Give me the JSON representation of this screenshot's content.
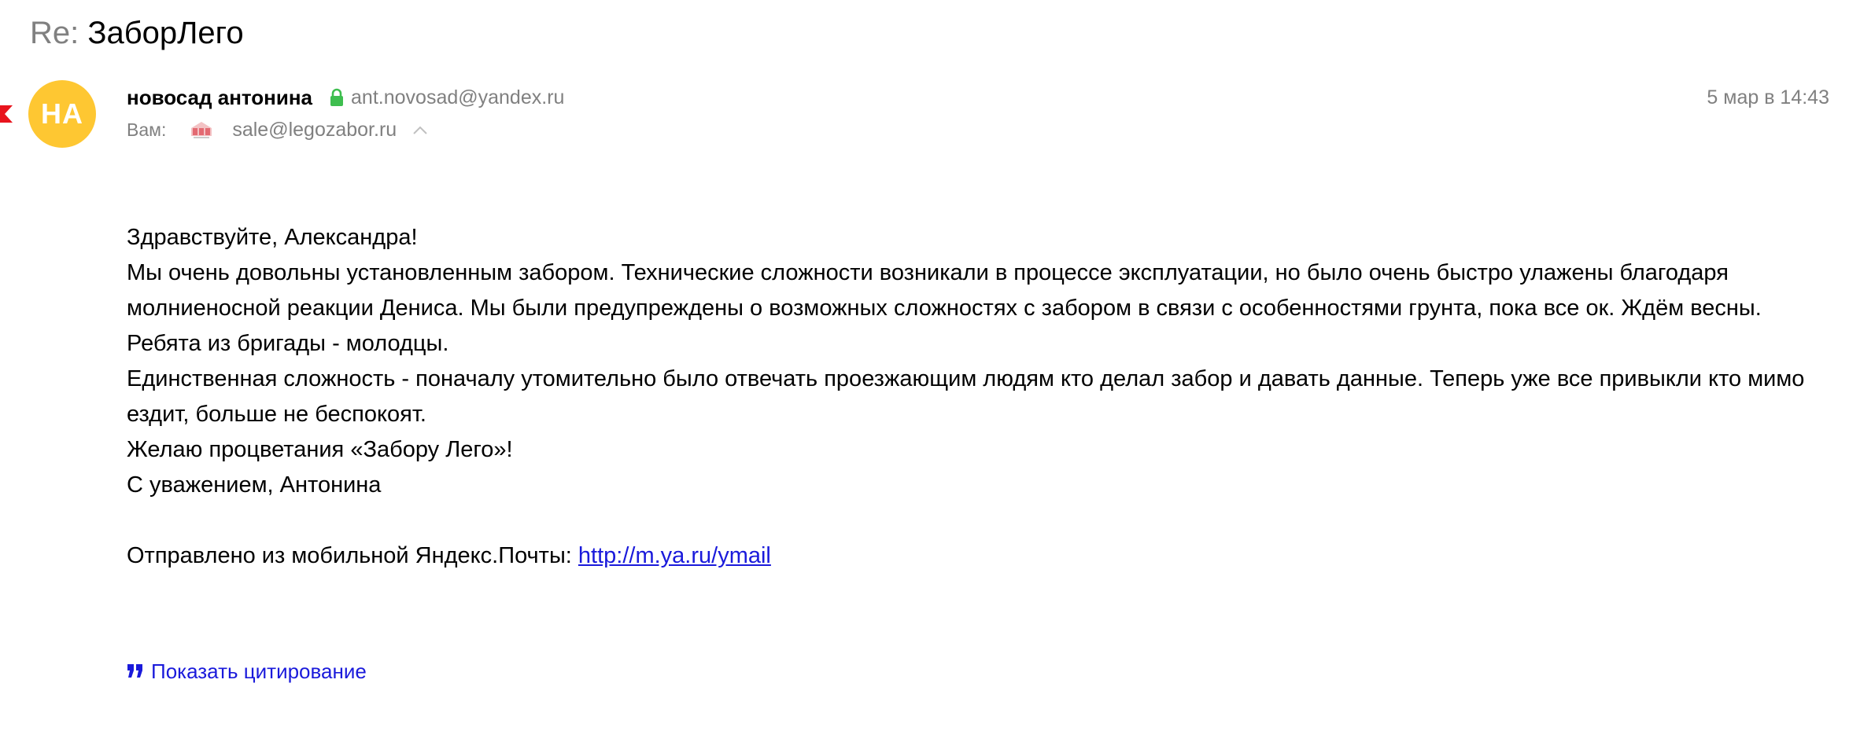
{
  "message": {
    "subject_prefix": "Re: ",
    "subject": "ЗаборЛего",
    "avatar_initials": "НА",
    "sender_name": "новосад антонина",
    "sender_email": "ant.novosad@yandex.ru",
    "to_label": "Вам:",
    "recipient_email": "sale@legozabor.ru",
    "date": "5 мар в 14:43"
  },
  "body": {
    "greeting": "Здравствуйте, Александра!",
    "paragraph_1": "Мы очень довольны установленным забором. Технические сложности возникали в процессе эксплуатации, но было очень быстро улажены благодаря молниеносной реакции Дениса. Мы были предупреждены о возможных сложностях с забором в связи с особенностями грунта, пока все ок. Ждём весны.",
    "paragraph_2": "Ребята из бригады - молодцы.",
    "paragraph_3": "Единственная сложность - поначалу утомительно было отвечать проезжающим людям кто делал забор и давать данные. Теперь уже все привыкли кто мимо ездит, больше не беспокоят.",
    "paragraph_4": "Желаю процветания «Забору Лего»!",
    "signature": "С уважением, Антонина",
    "sent_from_text": "Отправлено из мобильной Яндекс.Почты: ",
    "sent_from_link": "http://m.ya.ru/ymail"
  },
  "actions": {
    "show_quote": "Показать цитирование"
  },
  "icons": {
    "flag": "flag-icon",
    "lock": "lock-icon",
    "recipient_logo": "company-logo-icon",
    "expand": "chevron-up-icon",
    "quote": "quote-icon"
  },
  "colors": {
    "avatar": "#fec732",
    "flag": "#e8141d",
    "lock": "#3ebe4f",
    "link": "#1a1adb",
    "secondary_text": "#808080"
  }
}
